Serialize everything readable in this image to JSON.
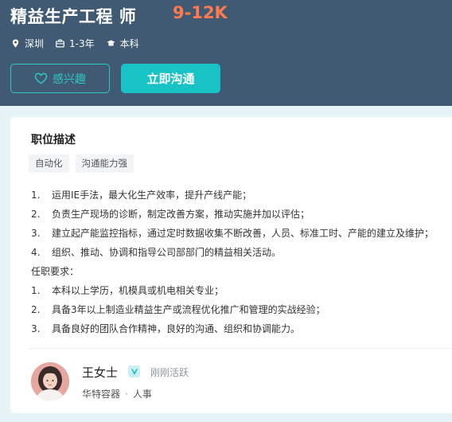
{
  "job": {
    "title": "精益生产工程 师",
    "salary": "9-12K",
    "location": "深圳",
    "experience": "1-3年",
    "education": "本科"
  },
  "actions": {
    "interest_label": "感兴趣",
    "chat_label": "立即沟通"
  },
  "description": {
    "section_title": "职位描述",
    "tags": [
      "自动化",
      "沟通能力强"
    ],
    "lines": [
      {
        "num": "1.",
        "text": "运用IE手法，最大化生产效率，提升产线产能；"
      },
      {
        "num": "2.",
        "text": "负责生产现场的诊断，制定改善方案，推动实施并加以评估；"
      },
      {
        "num": "3.",
        "text": "建立起产能监控指标，通过定时数据收集不断改善，人员、标准工时、产能的建立及维护；"
      },
      {
        "num": "4.",
        "text": "组织、推动、协调和指导公司部部门的精益相关活动。"
      },
      {
        "num": "",
        "text": "任职要求："
      },
      {
        "num": "1.",
        "text": "本科以上学历，机模具或机电相关专业；"
      },
      {
        "num": "2.",
        "text": "具备3年以上制造业精益生产或流程优化推广和管理的实战经验；"
      },
      {
        "num": "3.",
        "text": "具备良好的团队合作精神，良好的沟通、组织和协调能力。"
      }
    ]
  },
  "recruiter": {
    "name": "王女士",
    "status": "刚刚活跃",
    "company": "华特容器",
    "role": "人事"
  },
  "colors": {
    "header_bg": "#3f5a72",
    "salary": "#ff7a4f",
    "accent": "#18c3c6"
  },
  "icons": [
    "location-icon",
    "briefcase-icon",
    "graduation-cap-icon",
    "heart-icon",
    "verified-icon"
  ]
}
